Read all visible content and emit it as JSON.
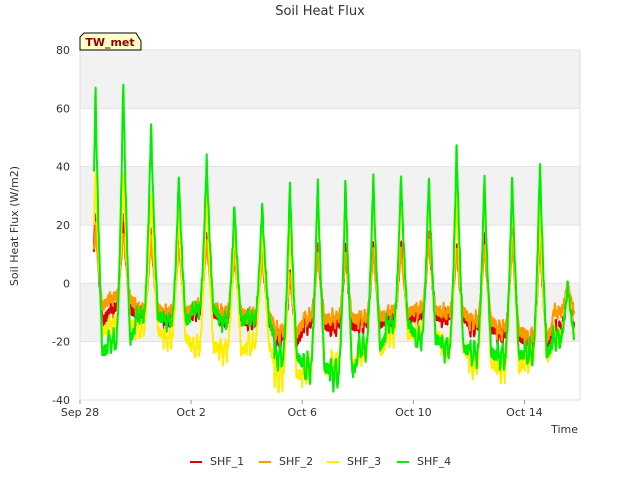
{
  "chart_data": {
    "type": "line",
    "title": "Soil Heat Flux",
    "xlabel": "Time",
    "ylabel": "Soil Heat Flux (W/m2)",
    "badge": "TW_met",
    "ylim": [
      -40,
      80
    ],
    "xlim": [
      "2023-09-28",
      "2023-10-16"
    ],
    "yticks": [
      -40,
      -20,
      0,
      20,
      40,
      60,
      80
    ],
    "xticks": [
      {
        "date": "2023-09-28",
        "label": "Sep 28"
      },
      {
        "date": "2023-10-02",
        "label": "Oct 2"
      },
      {
        "date": "2023-10-06",
        "label": "Oct 6"
      },
      {
        "date": "2023-10-10",
        "label": "Oct 10"
      },
      {
        "date": "2023-10-14",
        "label": "Oct 14"
      }
    ],
    "grid": true,
    "legend_position": "bottom",
    "background_bands": [
      "#ffffff",
      "#f2f2f2"
    ],
    "series_start": "2023-09-28T12:00",
    "series_end": "2023-10-15T19:00",
    "series": [
      {
        "name": "SHF_1",
        "color": "#dd0000",
        "daily_min": [
          -13,
          -9,
          -11,
          -12,
          -10,
          -12,
          -13,
          -20,
          -14,
          -15,
          -14,
          -12,
          -11,
          -12,
          -15,
          -18,
          -21,
          -16
        ],
        "daily_max": [
          26,
          24,
          20,
          17,
          18,
          12,
          12,
          5,
          14,
          13,
          15,
          15,
          18,
          14,
          17,
          19,
          18,
          0
        ]
      },
      {
        "name": "SHF_2",
        "color": "#ff9900",
        "daily_min": [
          -8,
          -5,
          -9,
          -10,
          -8,
          -10,
          -11,
          -17,
          -12,
          -12,
          -12,
          -10,
          -9,
          -10,
          -13,
          -16,
          -19,
          -10
        ],
        "daily_max": [
          20,
          18,
          16,
          14,
          15,
          10,
          10,
          4,
          11,
          11,
          12,
          12,
          15,
          12,
          14,
          16,
          15,
          0
        ]
      },
      {
        "name": "SHF_3",
        "color": "#ffee00",
        "daily_min": [
          -17,
          -14,
          -16,
          -19,
          -22,
          -23,
          -21,
          -32,
          -30,
          -28,
          -24,
          -18,
          -17,
          -22,
          -28,
          -29,
          -26,
          -18
        ],
        "daily_max": [
          40,
          38,
          32,
          26,
          35,
          22,
          22,
          24,
          34,
          33,
          36,
          35,
          32,
          32,
          36,
          33,
          28,
          0
        ]
      },
      {
        "name": "SHF_4",
        "color": "#00ee00",
        "daily_min": [
          -24,
          -20,
          -11,
          -13,
          -9,
          -13,
          -12,
          -25,
          -29,
          -31,
          -22,
          -14,
          -19,
          -22,
          -24,
          -25,
          -24,
          -19
        ],
        "daily_max": [
          68,
          71,
          56,
          38,
          44,
          28,
          28,
          36,
          37,
          37,
          38,
          38,
          38,
          49,
          38,
          38,
          43,
          0
        ]
      }
    ]
  }
}
